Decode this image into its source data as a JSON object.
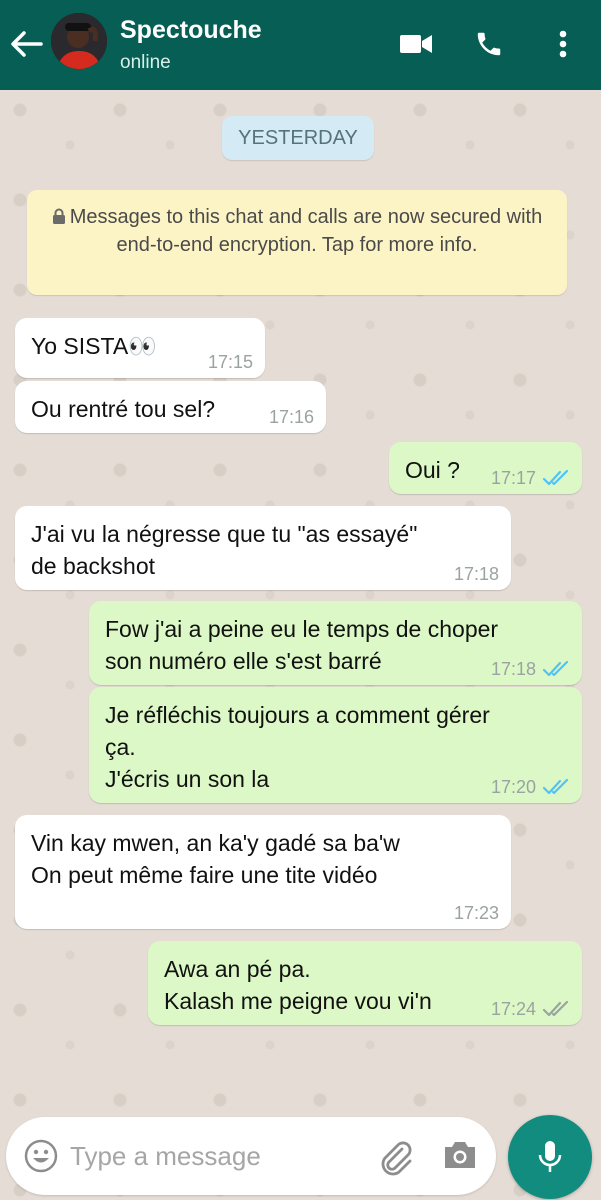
{
  "header": {
    "contact_name": "Spectouche",
    "status": "online",
    "icons": [
      "back-arrow-icon",
      "video-call-icon",
      "phone-icon",
      "more-vert-icon"
    ]
  },
  "chat": {
    "date_label": "YESTERDAY",
    "security_notice": "Messages to this chat and calls are now secured with end-to-end encryption. Tap for more info.",
    "messages": [
      {
        "dir": "in",
        "text": "Yo SISTA👀",
        "time": "17:15"
      },
      {
        "dir": "in",
        "text": "Ou rentré tou sel?",
        "time": "17:16"
      },
      {
        "dir": "out",
        "text": "Oui ?",
        "time": "17:17",
        "status": "read"
      },
      {
        "dir": "in",
        "text": "J'ai vu la négresse que tu \"as essayé\"\nde backshot",
        "time": "17:18"
      },
      {
        "dir": "out",
        "text": "Fow j'ai a peine eu le temps de choper\nson numéro elle s'est barré",
        "time": "17:18",
        "status": "read"
      },
      {
        "dir": "out",
        "text": "Je réfléchis toujours a comment gérer\nça.\nJ'écris un son la",
        "time": "17:20",
        "status": "read"
      },
      {
        "dir": "in",
        "text": "Vin kay mwen, an ka'y gadé sa ba'w\nOn peut même faire une tite vidéo",
        "time": "17:23"
      },
      {
        "dir": "out",
        "text": "Awa an pé pa.\nKalash me peigne vou vi'n",
        "time": "17:24",
        "status": "delivered"
      }
    ]
  },
  "composer": {
    "placeholder": "Type a message",
    "icons": [
      "emoji-icon",
      "attach-icon",
      "camera-icon",
      "mic-icon"
    ]
  },
  "colors": {
    "header": "#075e54",
    "outgoing_bubble": "#dcf8c6",
    "incoming_bubble": "#ffffff",
    "read_tick": "#4fc3f7",
    "mic_button": "#128c7e"
  }
}
